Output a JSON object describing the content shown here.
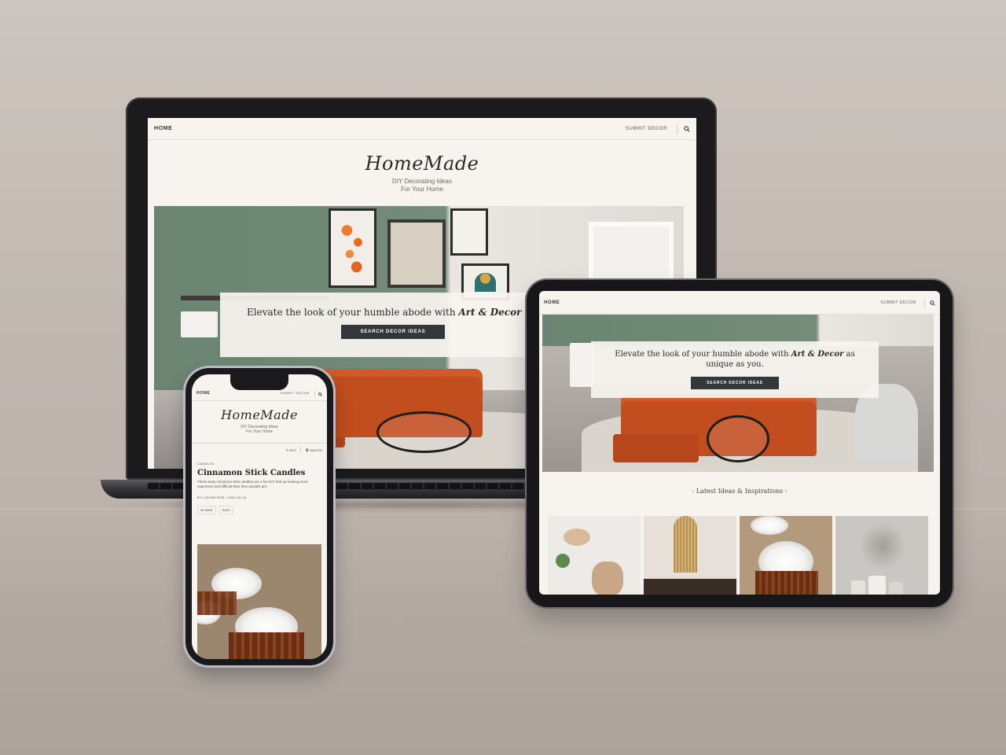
{
  "site": {
    "logo": "HomeMade",
    "tagline_line1": "DIY Decorating Ideas",
    "tagline_line2": "For Your Home",
    "nav_home": "HOME",
    "nav_submit": "SUBMIT DECOR",
    "search_icon": "search-icon"
  },
  "hero": {
    "text_before": "Elevate the look of your humble abode with ",
    "text_emphasis": "Art & Decor",
    "laptop_text_after": " as u",
    "tablet_text_after": " as unique as you.",
    "button": "SEARCH DECOR IDEAS"
  },
  "latest": {
    "heading": "- Latest Ideas & Inspirations -"
  },
  "article": {
    "edit_label": "EDIT",
    "delete_label": "DELETE",
    "category": "CANDLES",
    "title": "Cinnamon Stick Candles",
    "excerpt": "These easy cinnamon stick candles are a fun DIY that up looking more expensive and difficult than they actually are.",
    "byline": "BY LOUISE ROE / 2022-04-10",
    "time_tag": "30 MINS",
    "difficulty_tag": "EASY"
  },
  "colors": {
    "background": "#c6bdb6",
    "page": "#f7f4ef",
    "button": "#33363a",
    "sofa": "#c24d1f",
    "wall": "#6b8572"
  }
}
